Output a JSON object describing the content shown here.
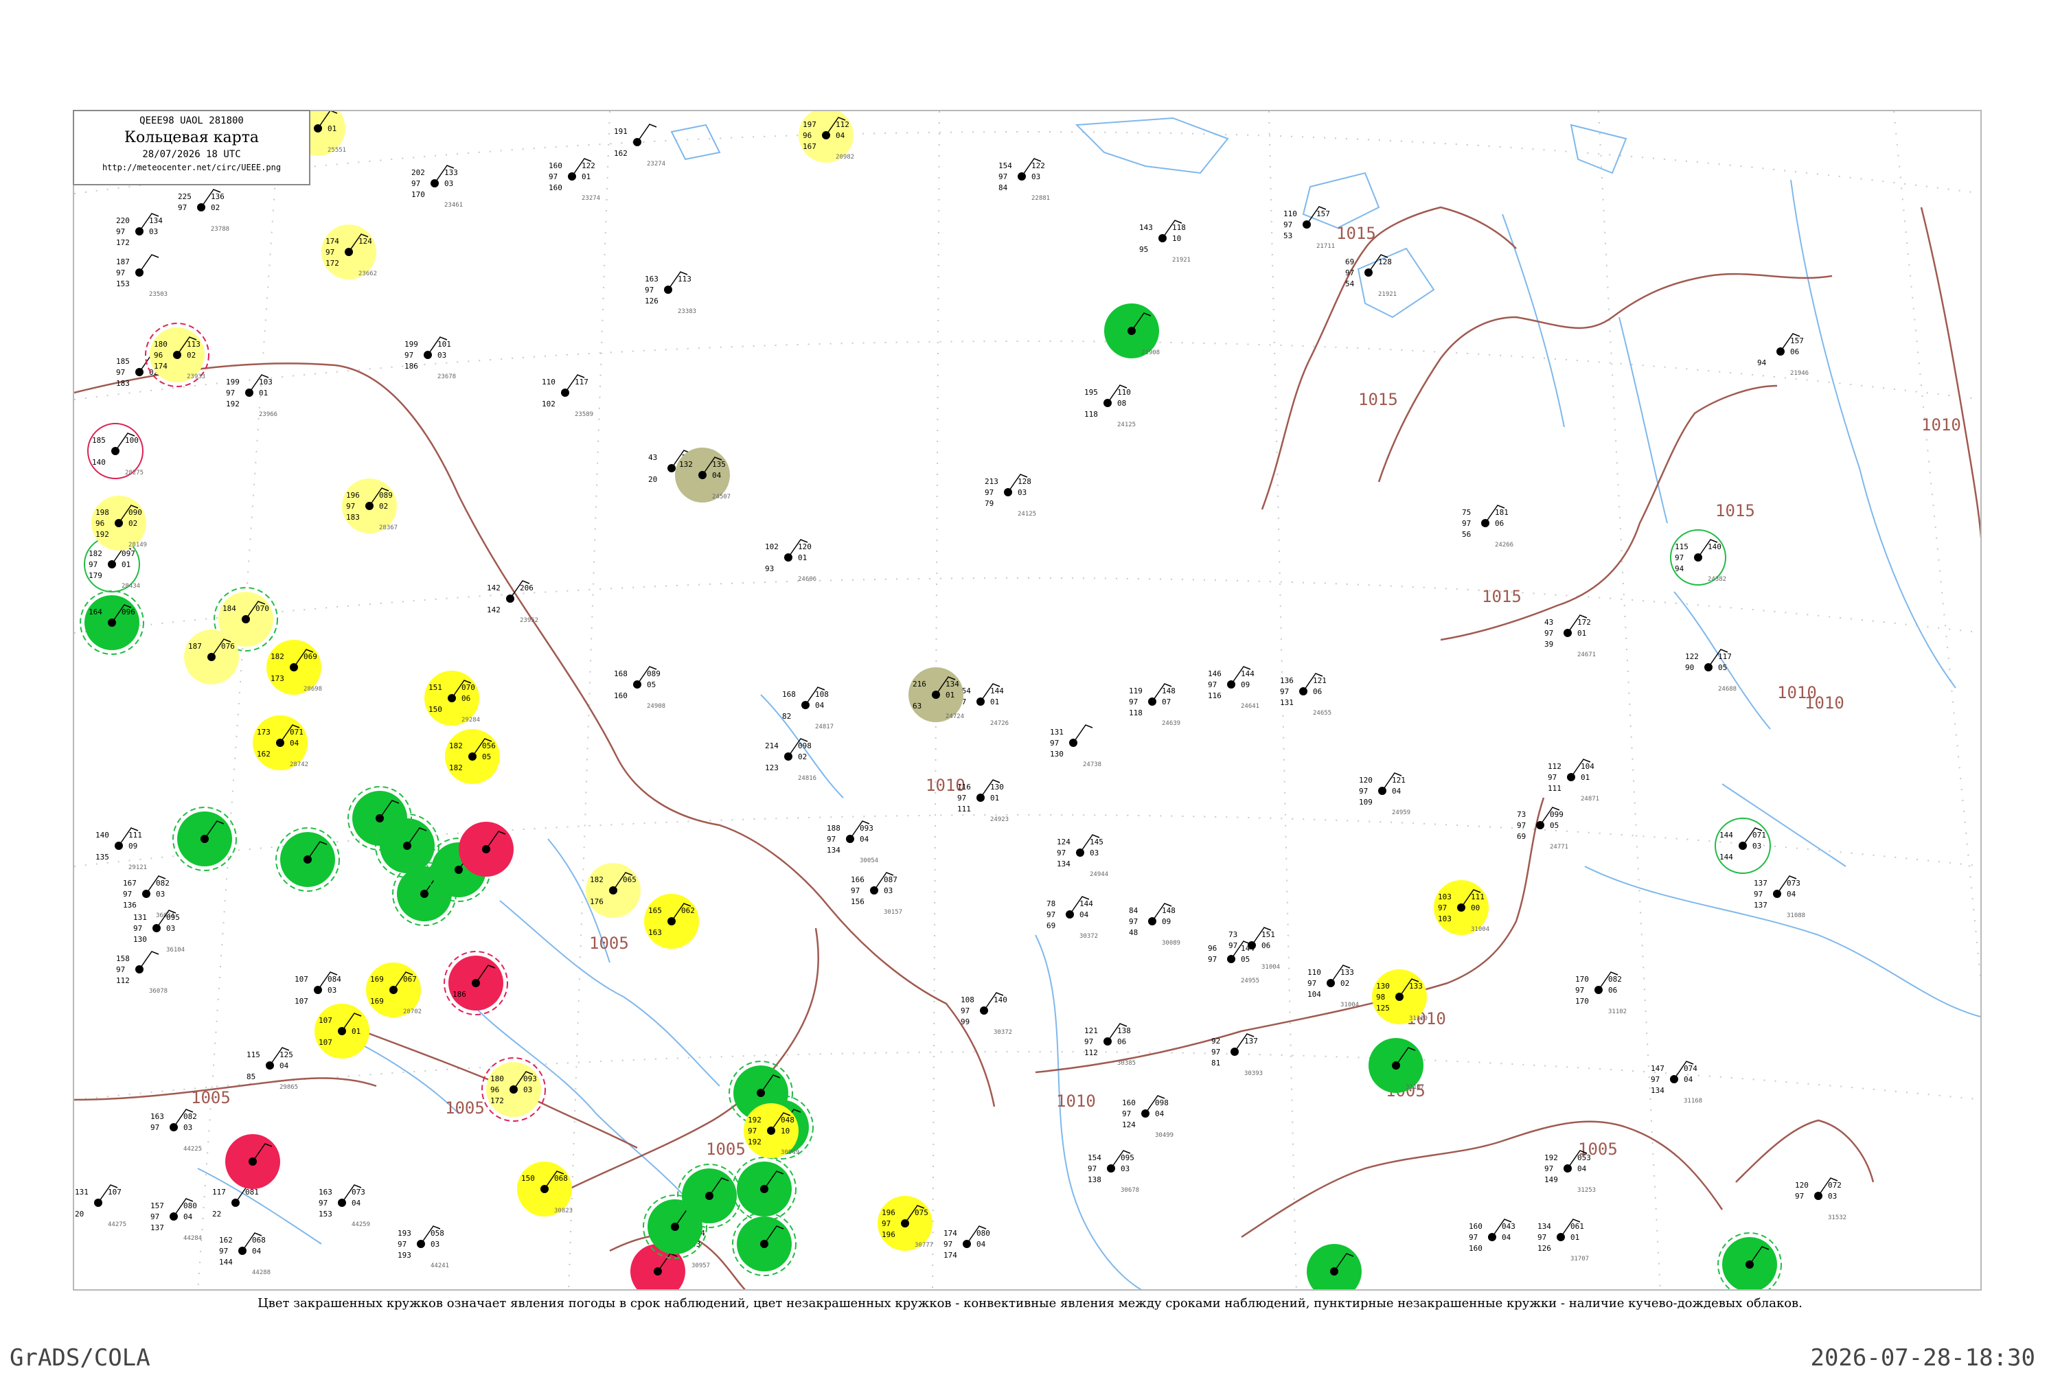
{
  "header": {
    "code": "QEEE98  UAOL  281800",
    "title": "Кольцевая карта",
    "date": "28/07/2026 18 UTC",
    "url": "http://meteocenter.net/circ/UEEE.png"
  },
  "caption": "Цвет закрашенных кружков означает явления погоды в срок наблюдений, цвет незакрашенных кружков - конвективные явления между сроками наблюдений, пунктирные незакрашенные кружки - наличие кучево-дождевых облаков.",
  "footer": {
    "left": "GrADS/COLA",
    "right": "2026-07-28-18:30"
  },
  "colors": {
    "isobar": "#a05a50",
    "water": "#7fb8ec",
    "grid": "#c8c8c8",
    "green": "#11c433",
    "yellow": "#ffff22",
    "pale_yellow": "#ffff88",
    "red": "#ee2255",
    "olive": "#bcbc8c",
    "ring_green": "#22bb44",
    "ring_red": "#dd2255"
  },
  "isobar_labels": [
    "1015",
    "1015",
    "1015",
    "1015",
    "1010",
    "1010",
    "1010",
    "1010",
    "1010",
    "1010",
    "1005",
    "1005",
    "1005",
    "1005",
    "1005",
    "1005"
  ],
  "stations": [
    {
      "name": "s-a",
      "fill": "pale_yellow",
      "ring": "",
      "tl": "146",
      "tr": "",
      "ml": "",
      "mr": "01",
      "bl": "",
      "id": "25551"
    },
    {
      "name": "s-b",
      "fill": "",
      "ring": "",
      "tl": "225",
      "tr": "136",
      "ml": "97",
      "mr": "02",
      "bl": "",
      "id": "23788"
    },
    {
      "name": "s-c",
      "fill": "pale_yellow",
      "ring": "ring_red",
      "tl": "180",
      "tr": "113",
      "ml": "96",
      "mr": "02",
      "bl": "174",
      "id": "23933"
    },
    {
      "name": "s-d",
      "fill": "",
      "ring": "ring_red",
      "tl": "185",
      "tr": "100",
      "ml": "",
      "mr": "",
      "bl": "140",
      "id": "28275"
    },
    {
      "name": "s-e",
      "fill": "",
      "ring": "ring_green",
      "tl": "182",
      "tr": "097",
      "ml": "97",
      "mr": "01",
      "bl": "179",
      "id": "28434"
    },
    {
      "name": "s-f",
      "fill": "green",
      "ring": "ring_green",
      "tl": "164",
      "tr": "096",
      "ml": "",
      "mr": "",
      "bl": "",
      "id": ""
    },
    {
      "name": "s-g",
      "fill": "pale_yellow",
      "ring": "",
      "tl": "196",
      "tr": "089",
      "ml": "97",
      "mr": "02",
      "bl": "183",
      "id": "28367"
    },
    {
      "name": "s-h",
      "fill": "pale_yellow",
      "ring": "",
      "tl": "174",
      "tr": "124",
      "ml": "97",
      "mr": "",
      "bl": "172",
      "id": "23662"
    },
    {
      "name": "s-i",
      "fill": "yellow",
      "ring": "",
      "tl": "151",
      "tr": "070",
      "ml": "",
      "mr": "06",
      "bl": "150",
      "id": "29284"
    },
    {
      "name": "s-j",
      "fill": "yellow",
      "ring": "",
      "tl": "182",
      "tr": "056",
      "ml": "",
      "mr": "05",
      "bl": "182",
      "id": ""
    },
    {
      "name": "s-k",
      "fill": "yellow",
      "ring": "",
      "tl": "173",
      "tr": "071",
      "ml": "",
      "mr": "04",
      "bl": "162",
      "id": "28742"
    },
    {
      "name": "s-l",
      "fill": "green",
      "ring": "ring_green",
      "tl": "",
      "tr": "",
      "ml": "",
      "mr": "",
      "bl": "",
      "id": ""
    },
    {
      "name": "s-m",
      "fill": "green",
      "ring": "ring_green",
      "tl": "",
      "tr": "",
      "ml": "",
      "mr": "",
      "bl": "",
      "id": ""
    },
    {
      "name": "s-n",
      "fill": "green",
      "ring": "ring_green",
      "tl": "",
      "tr": "",
      "ml": "",
      "mr": "",
      "bl": "",
      "id": ""
    },
    {
      "name": "s-o",
      "fill": "green",
      "ring": "ring_green",
      "tl": "",
      "tr": "",
      "ml": "",
      "mr": "",
      "bl": "",
      "id": ""
    },
    {
      "name": "s-p",
      "fill": "green",
      "ring": "ring_green",
      "tl": "",
      "tr": "",
      "ml": "",
      "mr": "",
      "bl": "",
      "id": ""
    },
    {
      "name": "s-q",
      "fill": "green",
      "ring": "ring_green",
      "tl": "",
      "tr": "",
      "ml": "",
      "mr": "",
      "bl": "",
      "id": ""
    },
    {
      "name": "s-r",
      "fill": "red",
      "ring": "",
      "tl": "",
      "tr": "",
      "ml": "",
      "mr": "",
      "bl": "",
      "id": ""
    },
    {
      "name": "s-s",
      "fill": "red",
      "ring": "ring_red",
      "tl": "",
      "tr": "",
      "ml": "",
      "mr": "",
      "bl": "186",
      "id": ""
    },
    {
      "name": "s-t",
      "fill": "yellow",
      "ring": "",
      "tl": "169",
      "tr": "067",
      "ml": "",
      "mr": "",
      "bl": "169",
      "id": "28702"
    },
    {
      "name": "s-u",
      "fill": "yellow",
      "ring": "",
      "tl": "107",
      "tr": "",
      "ml": "",
      "mr": "01",
      "bl": "107",
      "id": ""
    },
    {
      "name": "s-v",
      "fill": "pale_yellow",
      "ring": "",
      "tl": "182",
      "tr": "065",
      "ml": "",
      "mr": "",
      "bl": "176",
      "id": ""
    },
    {
      "name": "s-w",
      "fill": "yellow",
      "ring": "",
      "tl": "165",
      "tr": "062",
      "ml": "",
      "mr": "",
      "bl": "163",
      "id": ""
    },
    {
      "name": "s-x",
      "fill": "olive",
      "ring": "",
      "tl": "132",
      "tr": "135",
      "ml": "",
      "mr": "04",
      "bl": "",
      "id": "24507"
    },
    {
      "name": "s-y",
      "fill": "olive",
      "ring": "",
      "tl": "216",
      "tr": "134",
      "ml": "",
      "mr": "01",
      "bl": "63",
      "id": "24724"
    },
    {
      "name": "s-z",
      "fill": "pale_yellow",
      "ring": "",
      "tl": "197",
      "tr": "112",
      "ml": "96",
      "mr": "04",
      "bl": "167",
      "id": "20982"
    },
    {
      "name": "s-aa",
      "fill": "green",
      "ring": "",
      "tl": "",
      "tr": "",
      "ml": "",
      "mr": "",
      "bl": "",
      "id": "21908"
    },
    {
      "name": "s-ab",
      "fill": "yellow",
      "ring": "",
      "tl": "103",
      "tr": "111",
      "ml": "97",
      "mr": "00",
      "bl": "103",
      "id": "31004"
    },
    {
      "name": "s-ac",
      "fill": "yellow",
      "ring": "",
      "tl": "130",
      "tr": "133",
      "ml": "98",
      "mr": "",
      "bl": "125",
      "id": "31329"
    },
    {
      "name": "s-ad",
      "fill": "green",
      "ring": "",
      "tl": "",
      "tr": "",
      "ml": "",
      "mr": "",
      "bl": "",
      "id": "31167"
    },
    {
      "name": "s-ae",
      "fill": "",
      "ring": "ring_green",
      "tl": "115",
      "tr": "140",
      "ml": "97",
      "mr": "",
      "bl": "94",
      "id": "24382"
    },
    {
      "name": "s-af",
      "fill": "",
      "ring": "ring_green",
      "tl": "144",
      "tr": "071",
      "ml": "",
      "mr": "03",
      "bl": "144",
      "id": ""
    },
    {
      "name": "s-ag",
      "fill": "red",
      "ring": "",
      "tl": "",
      "tr": "",
      "ml": "",
      "mr": "",
      "bl": "",
      "id": ""
    },
    {
      "name": "s-ah",
      "fill": "red",
      "ring": "",
      "tl": "",
      "tr": "",
      "ml": "",
      "mr": "",
      "bl": "",
      "id": "30965"
    },
    {
      "name": "s-ai",
      "fill": "green",
      "ring": "ring_green",
      "tl": "",
      "tr": "",
      "ml": "",
      "mr": "",
      "bl": "",
      "id": ""
    },
    {
      "name": "s-aj",
      "fill": "green",
      "ring": "ring_green",
      "tl": "",
      "tr": "",
      "ml": "",
      "mr": "",
      "bl": "",
      "id": ""
    },
    {
      "name": "s-ak",
      "fill": "green",
      "ring": "ring_green",
      "tl": "",
      "tr": "",
      "ml": "",
      "mr": "",
      "bl": "",
      "id": ""
    },
    {
      "name": "s-al",
      "fill": "green",
      "ring": "ring_green",
      "tl": "",
      "tr": "",
      "ml": "",
      "mr": "",
      "bl": "",
      "id": ""
    },
    {
      "name": "s-am",
      "fill": "green",
      "ring": "ring_green",
      "tl": "",
      "tr": "",
      "ml": "",
      "mr": "",
      "bl": "",
      "id": ""
    },
    {
      "name": "s-an",
      "fill": "yellow",
      "ring": "",
      "tl": "196",
      "tr": "075",
      "ml": "97",
      "mr": "",
      "bl": "196",
      "id": "30777"
    },
    {
      "name": "s-ao",
      "fill": "green",
      "ring": "ring_green",
      "tl": "",
      "tr": "",
      "ml": "",
      "mr": "",
      "bl": "",
      "id": ""
    },
    {
      "name": "s-ap",
      "fill": "yellow",
      "ring": "",
      "tl": "182",
      "tr": "069",
      "ml": "",
      "mr": "",
      "bl": "173",
      "id": "28698"
    },
    {
      "name": "s-aq",
      "fill": "pale_yellow",
      "ring": "ring_green",
      "tl": "184",
      "tr": "070",
      "ml": "",
      "mr": "",
      "bl": "",
      "id": ""
    },
    {
      "name": "s-ar",
      "fill": "pale_yellow",
      "ring": "",
      "tl": "187",
      "tr": "076",
      "ml": "",
      "mr": "",
      "bl": "",
      "id": ""
    },
    {
      "name": "s-as",
      "fill": "pale_yellow",
      "ring": "",
      "tl": "198",
      "tr": "090",
      "ml": "96",
      "mr": "02",
      "bl": "192",
      "id": "28149"
    },
    {
      "name": "s-at",
      "fill": "pale_yellow",
      "ring": "ring_red",
      "tl": "180",
      "tr": "093",
      "ml": "96",
      "mr": "03",
      "bl": "172",
      "id": ""
    },
    {
      "name": "s-au",
      "fill": "yellow",
      "ring": "",
      "tl": "150",
      "tr": "068",
      "ml": "",
      "mr": "",
      "bl": "",
      "id": "30823"
    },
    {
      "name": "s-av",
      "fill": "yellow",
      "ring": "",
      "tl": "192",
      "tr": "048",
      "ml": "97",
      "mr": "10",
      "bl": "192",
      "id": "30949"
    },
    {
      "name": "s-aw",
      "fill": "green",
      "ring": "",
      "tl": "",
      "tr": "",
      "ml": "",
      "mr": "",
      "bl": "",
      "id": ""
    },
    {
      "name": "s-ax",
      "fill": "green",
      "ring": "ring_green",
      "tl": "",
      "tr": "",
      "ml": "",
      "mr": "",
      "bl": "",
      "id": ""
    }
  ],
  "plain_stations": [
    {
      "tl": "160",
      "tr": "122",
      "ml": "97",
      "mr": "01",
      "bl": "160",
      "id": "23274"
    },
    {
      "tl": "202",
      "tr": "133",
      "ml": "97",
      "mr": "03",
      "bl": "170",
      "id": "23461"
    },
    {
      "tl": "220",
      "tr": "134",
      "ml": "97",
      "mr": "03",
      "bl": "172",
      "id": ""
    },
    {
      "tl": "187",
      "tr": "",
      "ml": "97",
      "mr": "",
      "bl": "153",
      "id": "23503"
    },
    {
      "tl": "185",
      "tr": "",
      "ml": "97",
      "mr": "02",
      "bl": "183",
      "id": ""
    },
    {
      "tl": "199",
      "tr": "103",
      "ml": "97",
      "mr": "01",
      "bl": "192",
      "id": "23966"
    },
    {
      "tl": "199",
      "tr": "101",
      "ml": "97",
      "mr": "03",
      "bl": "186",
      "id": "23678"
    },
    {
      "tl": "163",
      "tr": "113",
      "ml": "97",
      "mr": "",
      "bl": "126",
      "id": "23383"
    },
    {
      "tl": "110",
      "tr": "117",
      "ml": "",
      "mr": "",
      "bl": "102",
      "id": "23589"
    },
    {
      "tl": "43",
      "tr": "122",
      "ml": "",
      "mr": "",
      "bl": "20",
      "id": "23699"
    },
    {
      "tl": "154",
      "tr": "122",
      "ml": "97",
      "mr": "03",
      "bl": "84",
      "id": "22881"
    },
    {
      "tl": "143",
      "tr": "118",
      "ml": "",
      "mr": "10",
      "bl": "95",
      "id": "21921"
    },
    {
      "tl": "110",
      "tr": "157",
      "ml": "97",
      "mr": "",
      "bl": "53",
      "id": "21711"
    },
    {
      "tl": "69",
      "tr": "128",
      "ml": "97",
      "mr": "",
      "bl": "54",
      "id": "21921"
    },
    {
      "tl": "",
      "tr": "157",
      "ml": "",
      "mr": "06",
      "bl": "94",
      "id": "21946"
    },
    {
      "tl": "195",
      "tr": "110",
      "ml": "",
      "mr": "08",
      "bl": "118",
      "id": "24125"
    },
    {
      "tl": "213",
      "tr": "128",
      "ml": "97",
      "mr": "03",
      "bl": "79",
      "id": "24125"
    },
    {
      "tl": "102",
      "tr": "120",
      "ml": "",
      "mr": "01",
      "bl": "93",
      "id": "24606"
    },
    {
      "tl": "168",
      "tr": "089",
      "ml": "",
      "mr": "05",
      "bl": "160",
      "id": "24908"
    },
    {
      "tl": "168",
      "tr": "108",
      "ml": "",
      "mr": "04",
      "bl": "82",
      "id": "24817"
    },
    {
      "tl": "214",
      "tr": "098",
      "ml": "",
      "mr": "02",
      "bl": "123",
      "id": "24816"
    },
    {
      "tl": "154",
      "tr": "144",
      "ml": "97",
      "mr": "01",
      "bl": "",
      "id": "24726"
    },
    {
      "tl": "119",
      "tr": "148",
      "ml": "97",
      "mr": "07",
      "bl": "118",
      "id": "24639"
    },
    {
      "tl": "146",
      "tr": "144",
      "ml": "97",
      "mr": "09",
      "bl": "116",
      "id": "24641"
    },
    {
      "tl": "136",
      "tr": "121",
      "ml": "97",
      "mr": "06",
      "bl": "131",
      "id": "24655"
    },
    {
      "tl": "75",
      "tr": "181",
      "ml": "97",
      "mr": "06",
      "bl": "56",
      "id": "24266"
    },
    {
      "tl": "43",
      "tr": "172",
      "ml": "97",
      "mr": "01",
      "bl": "39",
      "id": "24671"
    },
    {
      "tl": "122",
      "tr": "117",
      "ml": "90",
      "mr": "05",
      "bl": "",
      "id": "24688"
    },
    {
      "tl": "131",
      "tr": "",
      "ml": "97",
      "mr": "",
      "bl": "130",
      "id": "24738"
    },
    {
      "tl": "116",
      "tr": "130",
      "ml": "97",
      "mr": "01",
      "bl": "111",
      "id": "24923"
    },
    {
      "tl": "188",
      "tr": "093",
      "ml": "97",
      "mr": "04",
      "bl": "134",
      "id": "30054"
    },
    {
      "tl": "166",
      "tr": "087",
      "ml": "97",
      "mr": "03",
      "bl": "156",
      "id": "30157"
    },
    {
      "tl": "124",
      "tr": "145",
      "ml": "97",
      "mr": "03",
      "bl": "134",
      "id": "24944"
    },
    {
      "tl": "78",
      "tr": "144",
      "ml": "97",
      "mr": "04",
      "bl": "69",
      "id": "30372"
    },
    {
      "tl": "84",
      "tr": "148",
      "ml": "97",
      "mr": "09",
      "bl": "48",
      "id": "30089"
    },
    {
      "tl": "108",
      "tr": "140",
      "ml": "97",
      "mr": "",
      "bl": "99",
      "id": "30372"
    },
    {
      "tl": "121",
      "tr": "138",
      "ml": "97",
      "mr": "06",
      "bl": "112",
      "id": "30385"
    },
    {
      "tl": "92",
      "tr": "137",
      "ml": "97",
      "mr": "",
      "bl": "81",
      "id": "30393"
    },
    {
      "tl": "160",
      "tr": "098",
      "ml": "97",
      "mr": "04",
      "bl": "124",
      "id": "30499"
    },
    {
      "tl": "154",
      "tr": "095",
      "ml": "97",
      "mr": "03",
      "bl": "138",
      "id": "30678"
    },
    {
      "tl": "73",
      "tr": "151",
      "ml": "97",
      "mr": "06",
      "bl": "",
      "id": "31004"
    },
    {
      "tl": "110",
      "tr": "133",
      "ml": "97",
      "mr": "02",
      "bl": "104",
      "id": "31004"
    },
    {
      "tl": "96",
      "tr": "144",
      "ml": "97",
      "mr": "05",
      "bl": "",
      "id": "24955"
    },
    {
      "tl": "120",
      "tr": "121",
      "ml": "97",
      "mr": "04",
      "bl": "109",
      "id": "24959"
    },
    {
      "tl": "112",
      "tr": "104",
      "ml": "97",
      "mr": "01",
      "bl": "111",
      "id": "24871"
    },
    {
      "tl": "73",
      "tr": "099",
      "ml": "97",
      "mr": "05",
      "bl": "69",
      "id": "24771"
    },
    {
      "tl": "137",
      "tr": "073",
      "ml": "97",
      "mr": "04",
      "bl": "137",
      "id": "31088"
    },
    {
      "tl": "170",
      "tr": "082",
      "ml": "97",
      "mr": "06",
      "bl": "170",
      "id": "31102"
    },
    {
      "tl": "147",
      "tr": "074",
      "ml": "97",
      "mr": "04",
      "bl": "134",
      "id": "31168"
    },
    {
      "tl": "192",
      "tr": "053",
      "ml": "97",
      "mr": "04",
      "bl": "149",
      "id": "31253"
    },
    {
      "tl": "160",
      "tr": "043",
      "ml": "97",
      "mr": "04",
      "bl": "160",
      "id": ""
    },
    {
      "tl": "134",
      "tr": "061",
      "ml": "97",
      "mr": "01",
      "bl": "126",
      "id": "31707"
    },
    {
      "tl": "120",
      "tr": "072",
      "ml": "97",
      "mr": "03",
      "bl": "",
      "id": "31532"
    },
    {
      "tl": "131",
      "tr": "107",
      "ml": "",
      "mr": "",
      "bl": "20",
      "id": "44275"
    },
    {
      "tl": "163",
      "tr": "082",
      "ml": "97",
      "mr": "03",
      "bl": "",
      "id": "44225"
    },
    {
      "tl": "157",
      "tr": "080",
      "ml": "97",
      "mr": "04",
      "bl": "137",
      "id": "44284"
    },
    {
      "tl": "117",
      "tr": "081",
      "ml": "",
      "mr": "",
      "bl": "22",
      "id": ""
    },
    {
      "tl": "162",
      "tr": "068",
      "ml": "97",
      "mr": "04",
      "bl": "144",
      "id": "44288"
    },
    {
      "tl": "163",
      "tr": "073",
      "ml": "97",
      "mr": "04",
      "bl": "153",
      "id": "44259"
    },
    {
      "tl": "193",
      "tr": "058",
      "ml": "97",
      "mr": "03",
      "bl": "193",
      "id": "44241"
    },
    {
      "tl": "174",
      "tr": "080",
      "ml": "97",
      "mr": "04",
      "bl": "174",
      "id": ""
    },
    {
      "tl": "191",
      "tr": "064",
      "ml": "97",
      "mr": "03",
      "bl": "188",
      "id": "30957"
    },
    {
      "tl": "115",
      "tr": "125",
      "ml": "",
      "mr": "04",
      "bl": "85",
      "id": "29865"
    },
    {
      "tl": "158",
      "tr": "",
      "ml": "97",
      "mr": "",
      "bl": "112",
      "id": "36078"
    },
    {
      "tl": "167",
      "tr": "082",
      "ml": "97",
      "mr": "03",
      "bl": "136",
      "id": "36034"
    },
    {
      "tl": "131",
      "tr": "095",
      "ml": "97",
      "mr": "03",
      "bl": "130",
      "id": "36104"
    },
    {
      "tl": "140",
      "tr": "111",
      "ml": "",
      "mr": "09",
      "bl": "135",
      "id": "29121"
    },
    {
      "tl": "107",
      "tr": "084",
      "ml": "",
      "mr": "03",
      "bl": "107",
      "id": "29430"
    },
    {
      "tl": "142",
      "tr": "206",
      "ml": "",
      "mr": "",
      "bl": "142",
      "id": "23952"
    },
    {
      "tl": "191",
      "tr": "",
      "ml": "",
      "mr": "",
      "bl": "162",
      "id": "23274"
    }
  ]
}
